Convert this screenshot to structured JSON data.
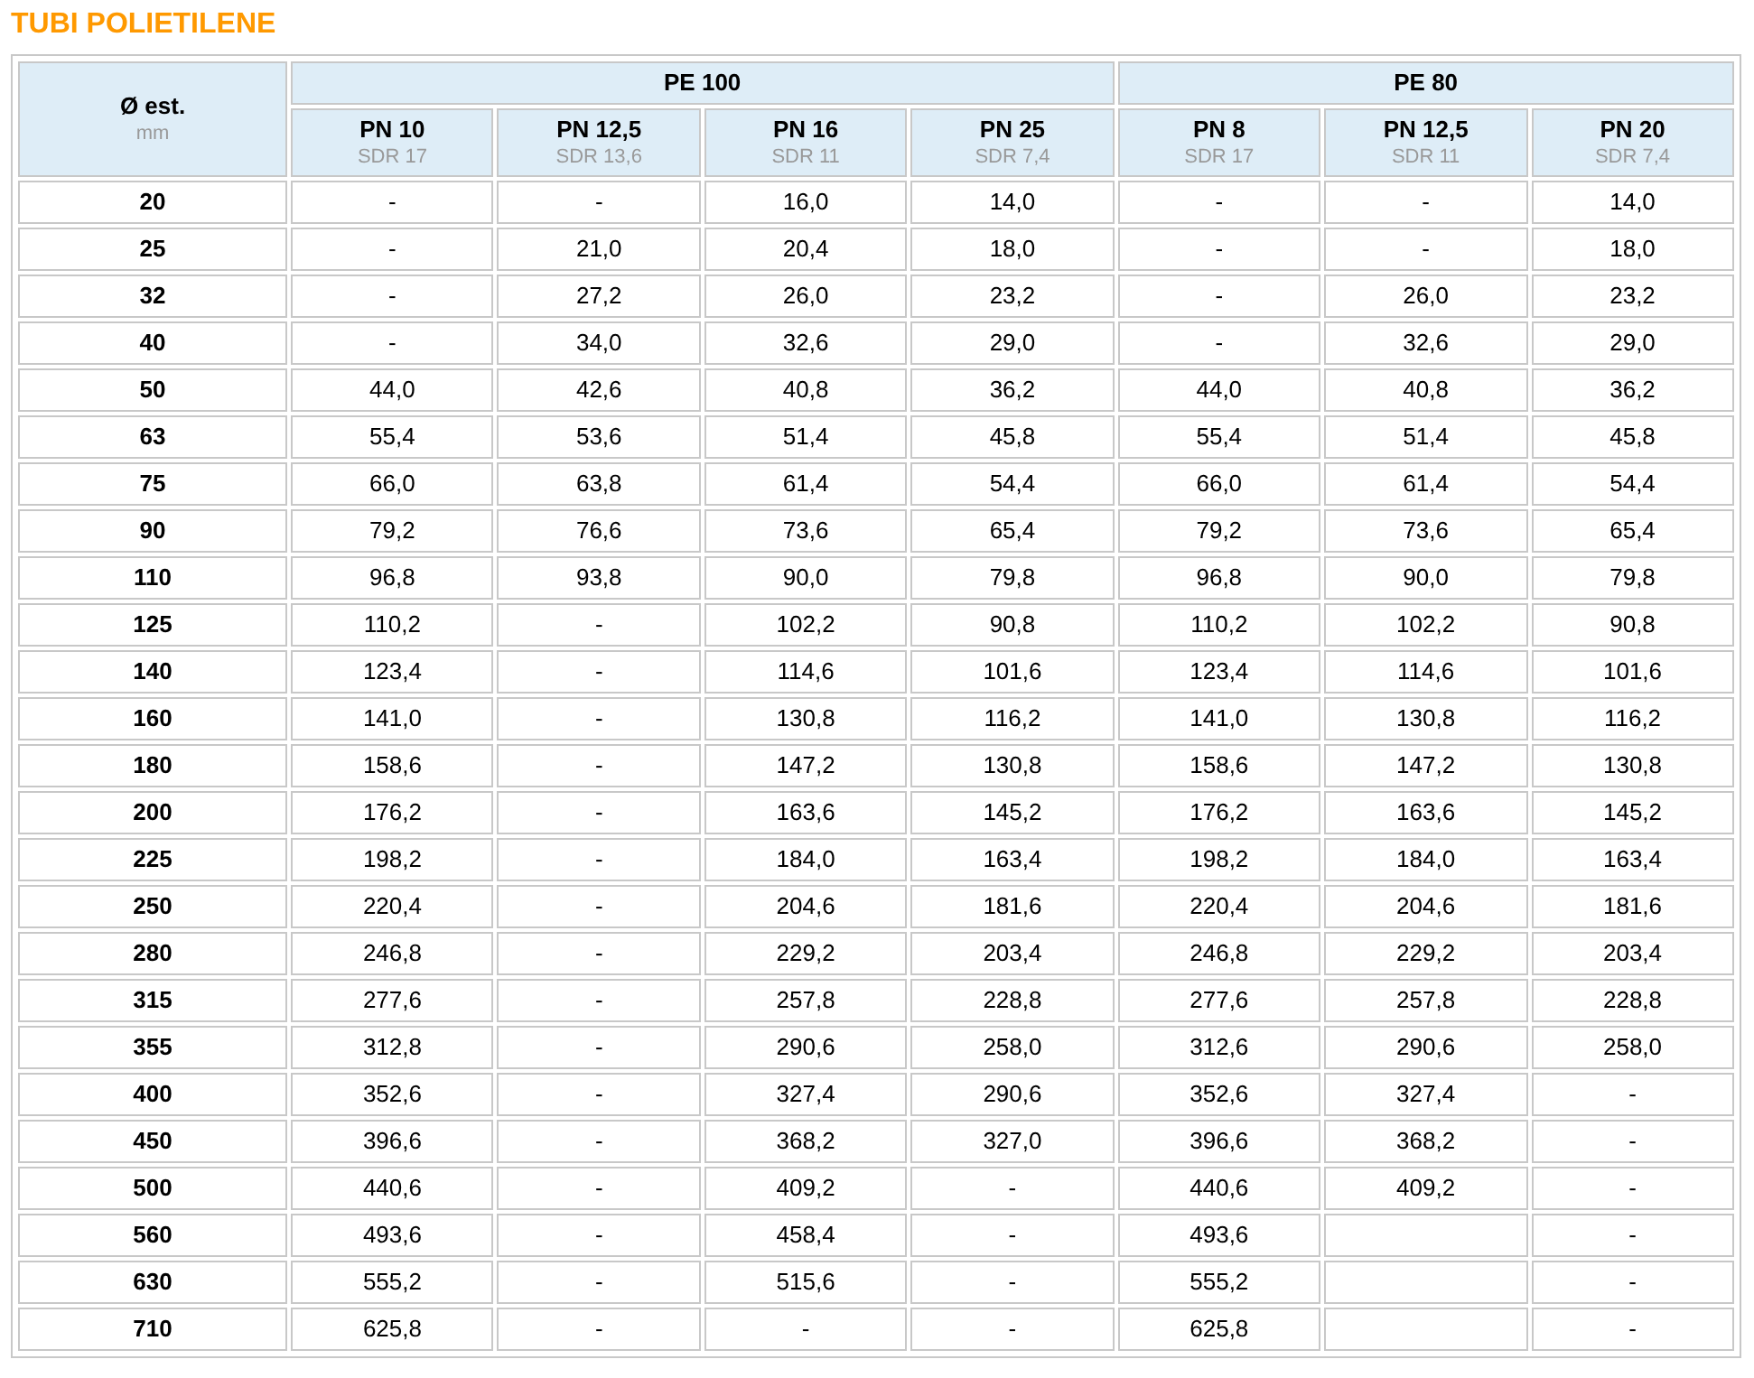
{
  "title": "TUBI POLIETILENE",
  "table": {
    "corner": {
      "label": "Ø est.",
      "unit": "mm"
    },
    "groups": [
      {
        "label": "PE 100",
        "columns": [
          {
            "pn": "PN 10",
            "sdr": "SDR 17"
          },
          {
            "pn": "PN 12,5",
            "sdr": "SDR 13,6"
          },
          {
            "pn": "PN 16",
            "sdr": "SDR 11"
          },
          {
            "pn": "PN 25",
            "sdr": "SDR 7,4"
          }
        ]
      },
      {
        "label": "PE 80",
        "columns": [
          {
            "pn": "PN 8",
            "sdr": "SDR 17"
          },
          {
            "pn": "PN 12,5",
            "sdr": "SDR 11"
          },
          {
            "pn": "PN 20",
            "sdr": "SDR 7,4"
          }
        ]
      }
    ],
    "rows": [
      {
        "size": "20",
        "values": [
          "-",
          "-",
          "16,0",
          "14,0",
          "-",
          "-",
          "14,0"
        ]
      },
      {
        "size": "25",
        "values": [
          "-",
          "21,0",
          "20,4",
          "18,0",
          "-",
          "-",
          "18,0"
        ]
      },
      {
        "size": "32",
        "values": [
          "-",
          "27,2",
          "26,0",
          "23,2",
          "-",
          "26,0",
          "23,2"
        ]
      },
      {
        "size": "40",
        "values": [
          "-",
          "34,0",
          "32,6",
          "29,0",
          "-",
          "32,6",
          "29,0"
        ]
      },
      {
        "size": "50",
        "values": [
          "44,0",
          "42,6",
          "40,8",
          "36,2",
          "44,0",
          "40,8",
          "36,2"
        ]
      },
      {
        "size": "63",
        "values": [
          "55,4",
          "53,6",
          "51,4",
          "45,8",
          "55,4",
          "51,4",
          "45,8"
        ]
      },
      {
        "size": "75",
        "values": [
          "66,0",
          "63,8",
          "61,4",
          "54,4",
          "66,0",
          "61,4",
          "54,4"
        ]
      },
      {
        "size": "90",
        "values": [
          "79,2",
          "76,6",
          "73,6",
          "65,4",
          "79,2",
          "73,6",
          "65,4"
        ]
      },
      {
        "size": "110",
        "values": [
          "96,8",
          "93,8",
          "90,0",
          "79,8",
          "96,8",
          "90,0",
          "79,8"
        ]
      },
      {
        "size": "125",
        "values": [
          "110,2",
          "-",
          "102,2",
          "90,8",
          "110,2",
          "102,2",
          "90,8"
        ]
      },
      {
        "size": "140",
        "values": [
          "123,4",
          "-",
          "114,6",
          "101,6",
          "123,4",
          "114,6",
          "101,6"
        ]
      },
      {
        "size": "160",
        "values": [
          "141,0",
          "-",
          "130,8",
          "116,2",
          "141,0",
          "130,8",
          "116,2"
        ]
      },
      {
        "size": "180",
        "values": [
          "158,6",
          "-",
          "147,2",
          "130,8",
          "158,6",
          "147,2",
          "130,8"
        ]
      },
      {
        "size": "200",
        "values": [
          "176,2",
          "-",
          "163,6",
          "145,2",
          "176,2",
          "163,6",
          "145,2"
        ]
      },
      {
        "size": "225",
        "values": [
          "198,2",
          "-",
          "184,0",
          "163,4",
          "198,2",
          "184,0",
          "163,4"
        ]
      },
      {
        "size": "250",
        "values": [
          "220,4",
          "-",
          "204,6",
          "181,6",
          "220,4",
          "204,6",
          "181,6"
        ]
      },
      {
        "size": "280",
        "values": [
          "246,8",
          "-",
          "229,2",
          "203,4",
          "246,8",
          "229,2",
          "203,4"
        ]
      },
      {
        "size": "315",
        "values": [
          "277,6",
          "-",
          "257,8",
          "228,8",
          "277,6",
          "257,8",
          "228,8"
        ]
      },
      {
        "size": "355",
        "values": [
          "312,8",
          "-",
          "290,6",
          "258,0",
          "312,6",
          "290,6",
          "258,0"
        ]
      },
      {
        "size": "400",
        "values": [
          "352,6",
          "-",
          "327,4",
          "290,6",
          "352,6",
          "327,4",
          "-"
        ]
      },
      {
        "size": "450",
        "values": [
          "396,6",
          "-",
          "368,2",
          "327,0",
          "396,6",
          "368,2",
          "-"
        ]
      },
      {
        "size": "500",
        "values": [
          "440,6",
          "-",
          "409,2",
          "-",
          "440,6",
          "409,2",
          "-"
        ]
      },
      {
        "size": "560",
        "values": [
          "493,6",
          "-",
          "458,4",
          "-",
          "493,6",
          {
            "blank": true
          },
          "-"
        ]
      },
      {
        "size": "630",
        "values": [
          "555,2",
          "-",
          "515,6",
          "-",
          "555,2",
          {
            "blank": true
          },
          "-"
        ]
      },
      {
        "size": "710",
        "values": [
          "625,8",
          "-",
          "-",
          "-",
          "625,8",
          {
            "blank": true
          },
          "-"
        ]
      }
    ]
  }
}
